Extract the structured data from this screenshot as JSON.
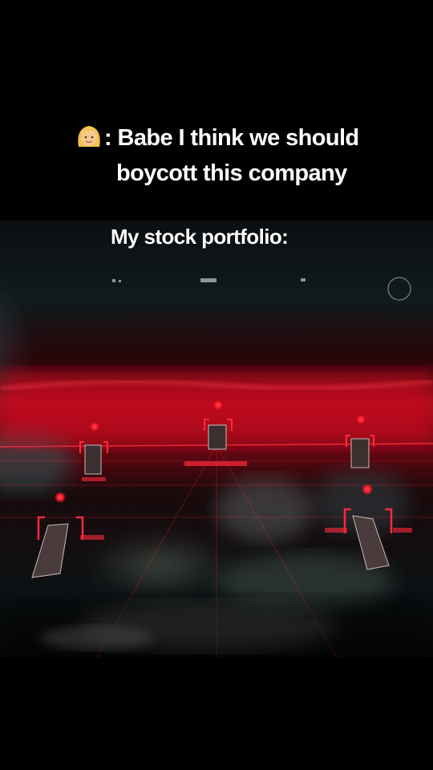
{
  "caption": {
    "emoji_icon": "woman-blonde-hair-icon",
    "line1_text": ": Babe I think we should",
    "line2_text": "boycott this company",
    "line3_text": "My stock portfolio:"
  },
  "colors": {
    "background": "#000000",
    "caption_text": "#ffffff",
    "hud_red": "#ff2a3a"
  }
}
